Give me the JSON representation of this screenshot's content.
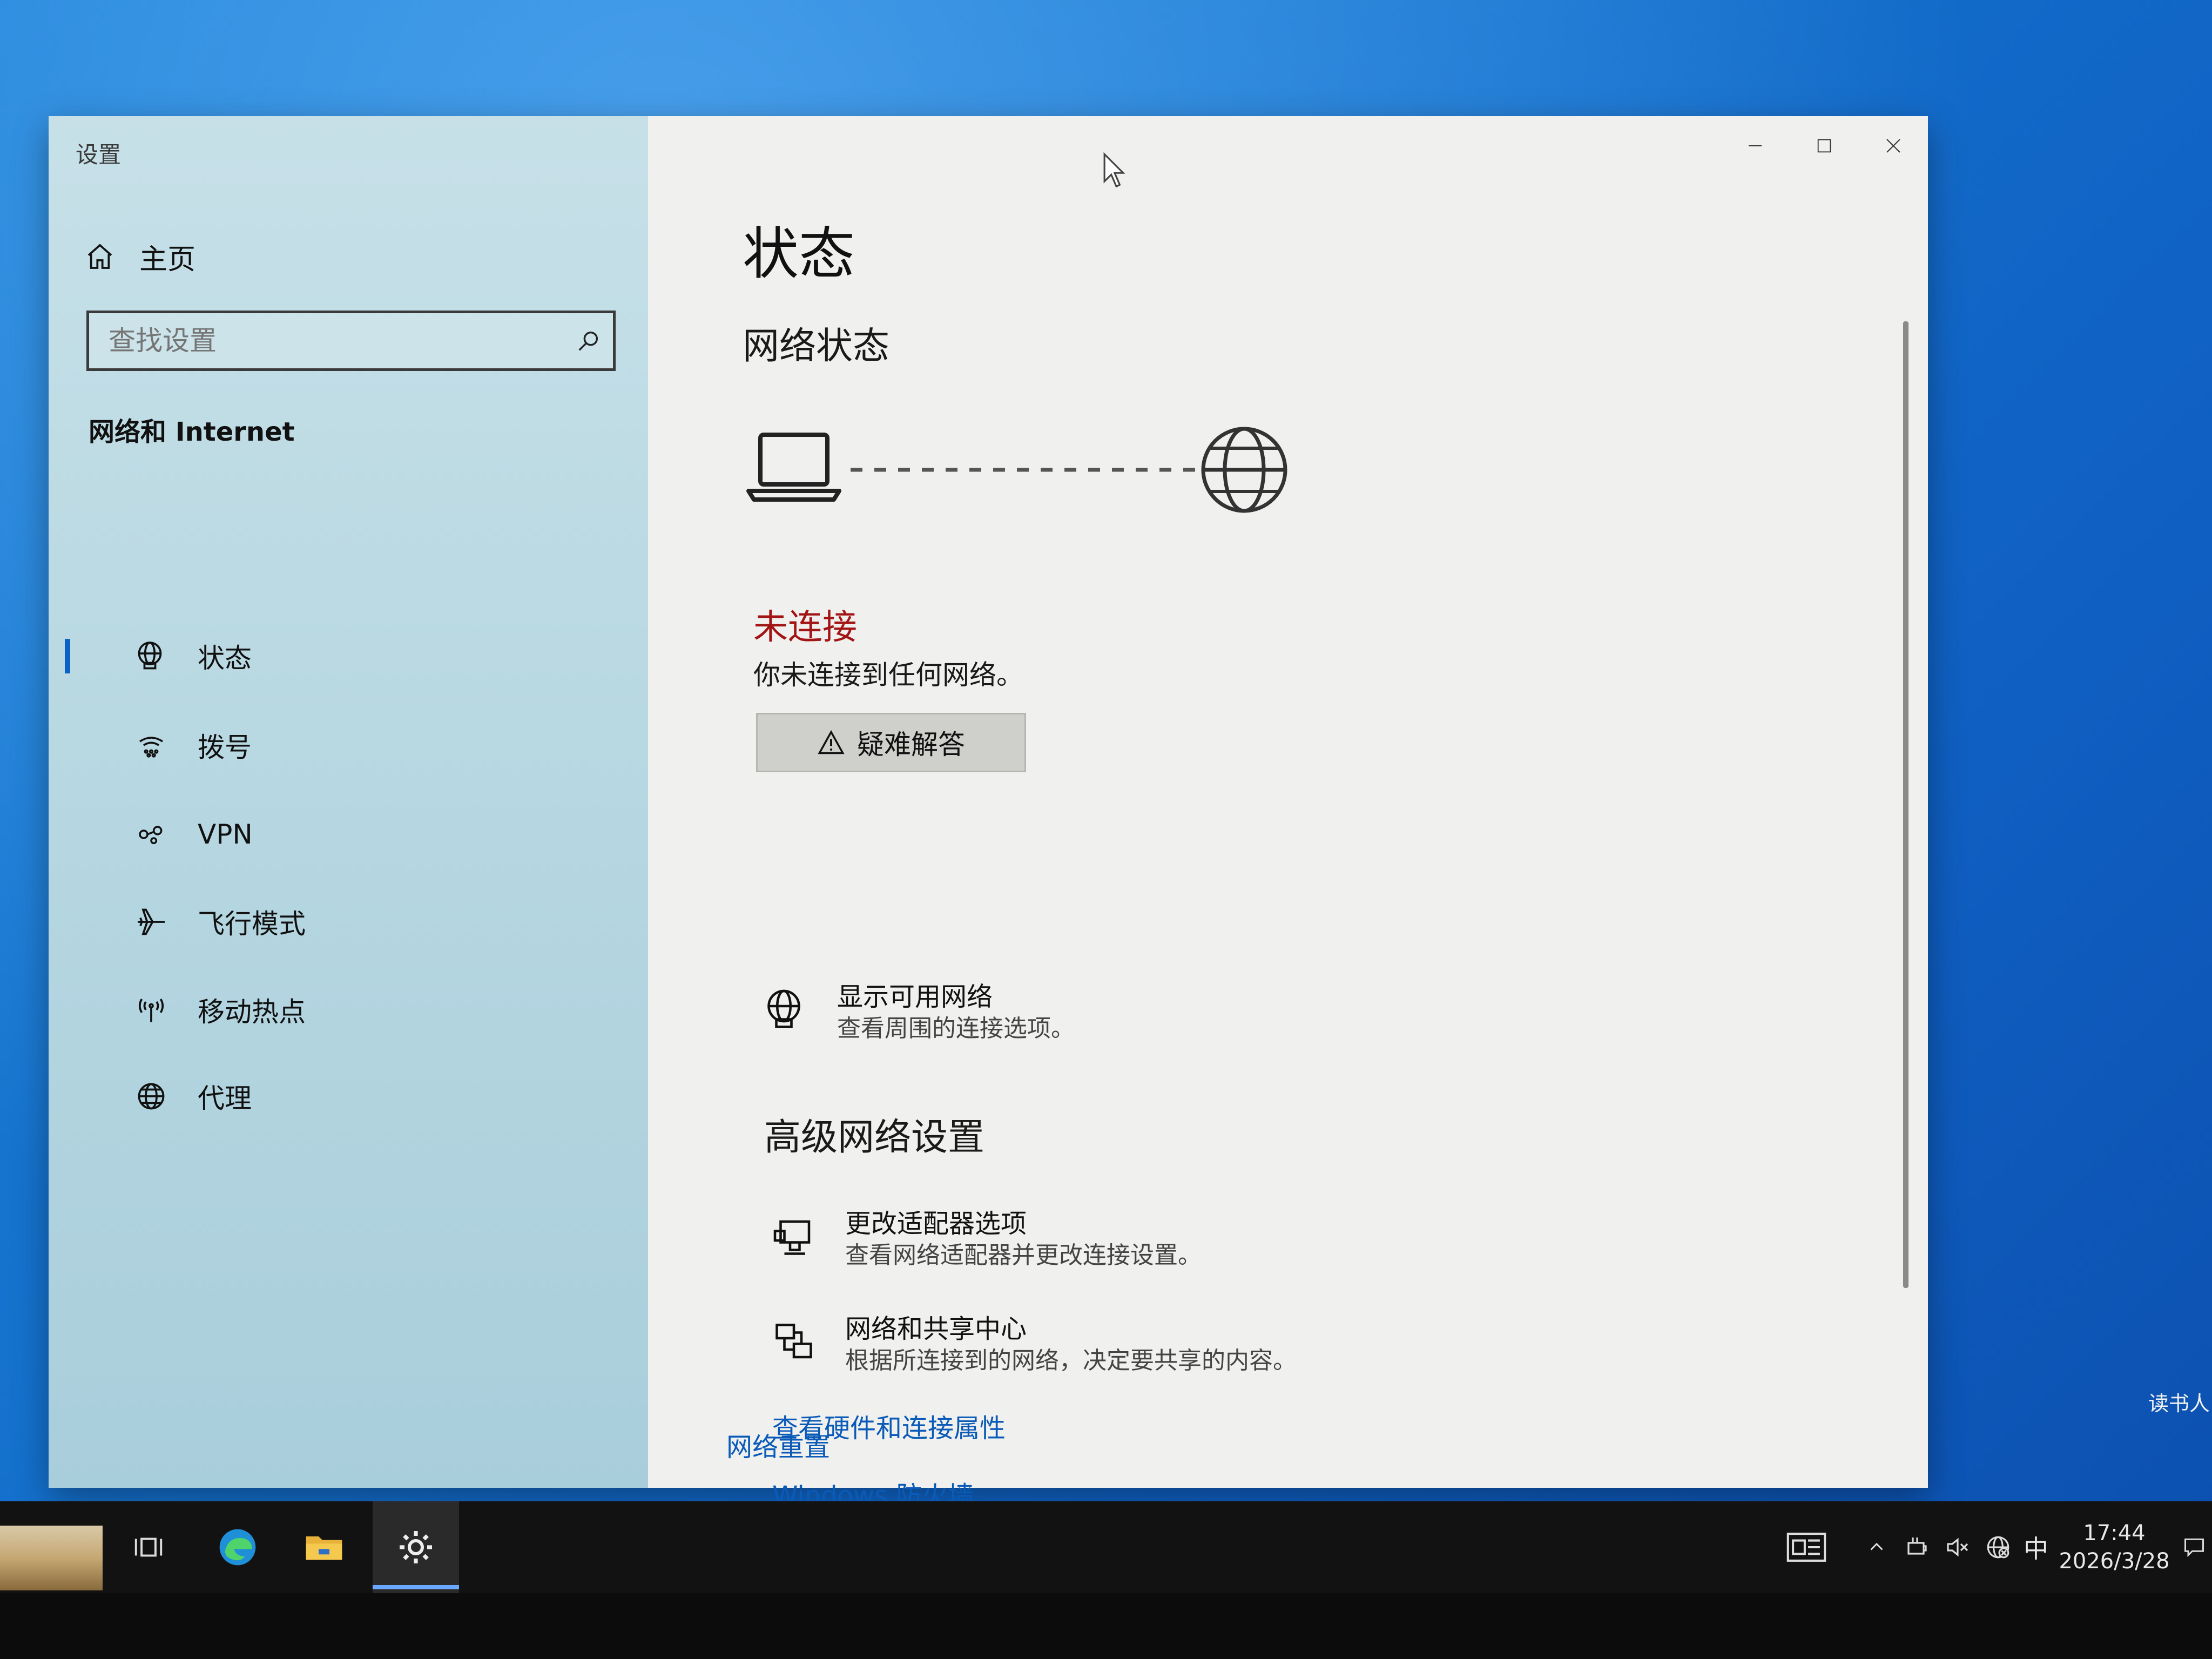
{
  "window": {
    "app_title": "设置",
    "controls": {
      "minimize": "minimize-icon",
      "maximize": "maximize-icon",
      "close": "close-icon"
    }
  },
  "sidebar": {
    "home_label": "主页",
    "search_placeholder": "查找设置",
    "section_heading": "网络和 Internet",
    "items": [
      {
        "label": "状态",
        "icon": "network-status-icon",
        "active": true
      },
      {
        "label": "拨号",
        "icon": "dialup-icon"
      },
      {
        "label": "VPN",
        "icon": "vpn-icon"
      },
      {
        "label": "飞行模式",
        "icon": "airplane-icon"
      },
      {
        "label": "移动热点",
        "icon": "hotspot-icon"
      },
      {
        "label": "代理",
        "icon": "globe-icon"
      }
    ]
  },
  "main": {
    "page_title": "状态",
    "network_status_heading": "网络状态",
    "status_text": "未连接",
    "status_description": "你未连接到任何网络。",
    "troubleshoot_label": "疑难解答",
    "show_networks": {
      "title": "显示可用网络",
      "subtitle": "查看周围的连接选项。"
    },
    "advanced_heading": "高级网络设置",
    "adapter_options": {
      "title": "更改适配器选项",
      "subtitle": "查看网络适配器并更改连接设置。"
    },
    "sharing_center": {
      "title": "网络和共享中心",
      "subtitle": "根据所连接到的网络，决定要共享的内容。"
    },
    "links": [
      "查看硬件和连接属性",
      "Windows 防火墙",
      "网络重置"
    ]
  },
  "taskbar": {
    "apps": [
      "task-view-icon",
      "edge-icon",
      "file-explorer-icon",
      "settings-icon"
    ],
    "tray": {
      "ime": "中",
      "time": "17:44",
      "date": "2026/3/28"
    }
  },
  "desktop": {
    "edge_text": "读书人"
  },
  "colors": {
    "status_red": "#a31515",
    "link_blue": "#0a5ab8",
    "accent": "#0b62c7"
  }
}
